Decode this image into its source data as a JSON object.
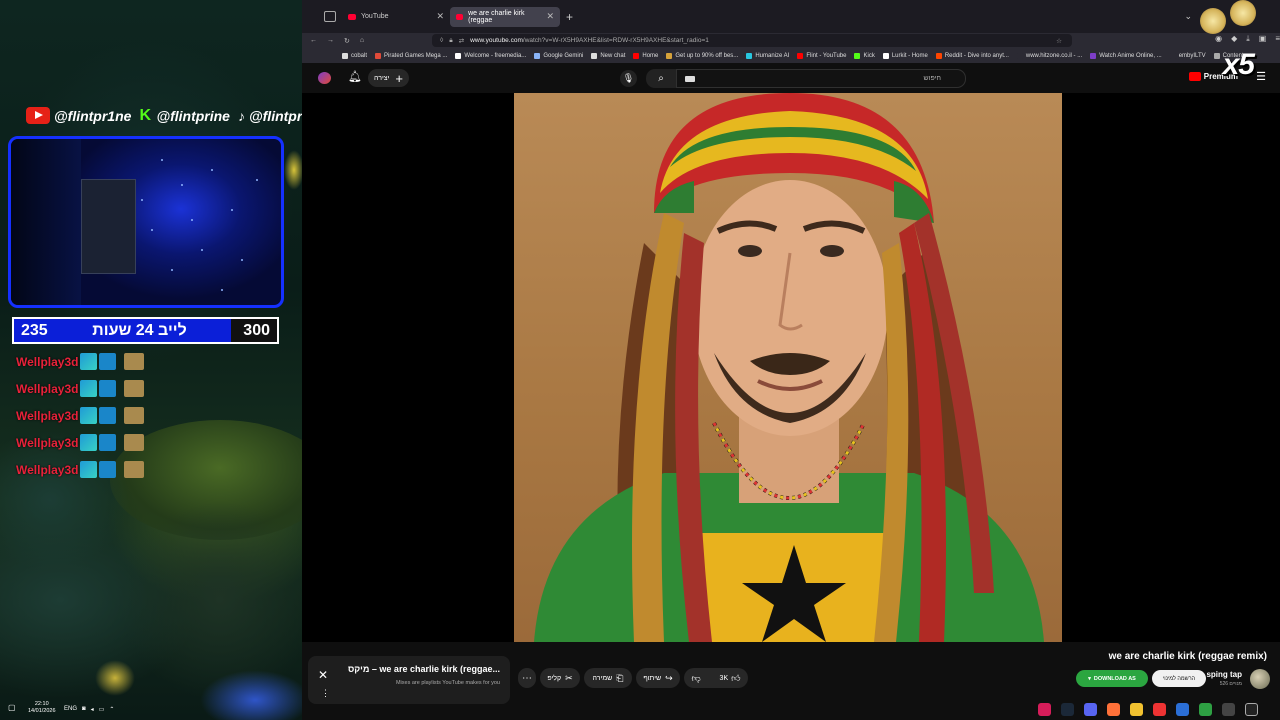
{
  "overlay": {
    "socials": [
      {
        "platform_icon": "youtube-icon",
        "handle": "@flintpr1ne"
      },
      {
        "platform_icon": "kick-icon",
        "handle": "@flintprine"
      },
      {
        "platform_icon": "tiktok-icon",
        "handle": "@flintprine"
      }
    ],
    "subathon": {
      "left_value": "235",
      "label": "לייב 24 שעות",
      "right_value": "300"
    },
    "events": [
      {
        "name": "Wellplay3d"
      },
      {
        "name": "Wellplay3d"
      },
      {
        "name": "Wellplay3d"
      },
      {
        "name": "Wellplay3d"
      },
      {
        "name": "Wellplay3d"
      }
    ],
    "combo": "x5"
  },
  "browser": {
    "tabs": [
      {
        "title": "YouTube",
        "active": false
      },
      {
        "title": "we are charlie kirk (reggae",
        "active": true
      }
    ],
    "url_domain": "www.youtube.com",
    "url_rest": "/watch?v=W-rX5H9AXHE&list=RDW-rX5H9AXHE&start_radio=1",
    "bookmarks": [
      {
        "label": "cobalt",
        "color": "#dddddd"
      },
      {
        "label": "Pirated Games Mega ...",
        "color": "#e04a39"
      },
      {
        "label": "Welcome - freemedia...",
        "color": "#ffffff"
      },
      {
        "label": "Google Gemini",
        "color": "#8ab4f8"
      },
      {
        "label": "New chat",
        "color": "#dddddd"
      },
      {
        "label": "Home",
        "color": "#ff0000"
      },
      {
        "label": "Get up to 90% off bes...",
        "color": "#d6a23a"
      },
      {
        "label": "Humanize AI",
        "color": "#28c7e0"
      },
      {
        "label": "Flint - YouTube",
        "color": "#ff0000"
      },
      {
        "label": "Kick",
        "color": "#53fc18"
      },
      {
        "label": "Lurkit - Home",
        "color": "#ffffff"
      },
      {
        "label": "Reddit - Dive into anyt...",
        "color": "#ff4500"
      },
      {
        "label": "www.hitzone.co.il - ...",
        "color": "#2b2a33"
      },
      {
        "label": "Watch Anime Online, ...",
        "color": "#7e3ec9"
      },
      {
        "label": "embyILTV",
        "color": "#2b2a33"
      },
      {
        "label": "Content",
        "color": "#aaaaaa"
      }
    ]
  },
  "youtube": {
    "create_label": "יצירה",
    "search_placeholder": "חיפוש",
    "logo_text": "Premium",
    "bell_icon": "bell-icon",
    "mix": {
      "title": "מיקס – we are charlie kirk (reggae...",
      "subtitle": "Mixes are playlists YouTube makes for you"
    },
    "actions": {
      "clip": "קליפ",
      "save": "שמירה",
      "share": "שיתוף",
      "likes": "3K"
    },
    "video_title": "we are charlie kirk (reggae remix)",
    "channel": {
      "name": "sping tap",
      "subs": "526 מנויים"
    },
    "subscribe_label": "הרשמה למינוי",
    "download_label": "DOWNLOAD AS"
  },
  "taskbar": {
    "time": "22:10",
    "date": "14/01/2026",
    "lang": "ENG"
  }
}
